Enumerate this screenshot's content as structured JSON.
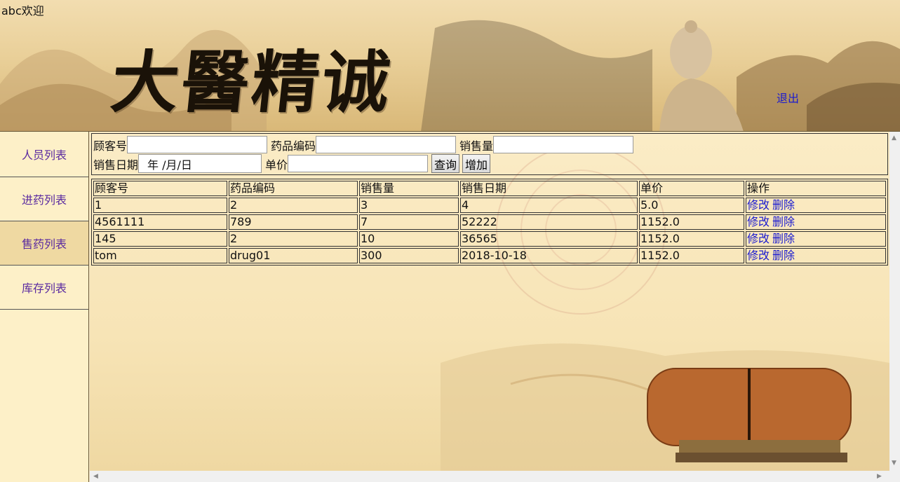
{
  "header": {
    "welcome": "abc欢迎",
    "logout": "退出"
  },
  "sidebar": {
    "items": [
      {
        "label": "人员列表",
        "active": false
      },
      {
        "label": "进药列表",
        "active": false
      },
      {
        "label": "售药列表",
        "active": true
      },
      {
        "label": "库存列表",
        "active": false
      }
    ]
  },
  "form": {
    "customer_label": "顾客号",
    "customer_value": "",
    "drug_code_label": "药品编码",
    "drug_code_value": "",
    "quantity_label": "销售量",
    "quantity_value": "",
    "date_label": "销售日期",
    "date_value": "年  /月/日",
    "price_label": "单价",
    "price_value": "",
    "query_button": "查询",
    "add_button": "增加"
  },
  "table": {
    "headers": [
      "顾客号",
      "药品编码",
      "销售量",
      "销售日期",
      "单价",
      "操作"
    ],
    "rows": [
      {
        "customer": "1",
        "drug_code": "2",
        "quantity": "3",
        "date": "4",
        "price": "5.0",
        "edit": "修改",
        "delete": "删除"
      },
      {
        "customer": "4561111",
        "drug_code": "789",
        "quantity": "7",
        "date": "52222",
        "price": "1152.0",
        "edit": "修改",
        "delete": "删除"
      },
      {
        "customer": "145",
        "drug_code": "2",
        "quantity": "10",
        "date": "36565",
        "price": "1152.0",
        "edit": "修改",
        "delete": "删除"
      },
      {
        "customer": "tom",
        "drug_code": "drug01",
        "quantity": "300",
        "date": "2018-10-18",
        "price": "1152.0",
        "edit": "修改",
        "delete": "删除"
      }
    ]
  },
  "colors": {
    "link": "#1a1ad0",
    "sidebar_text": "#5a2aa0",
    "sidebar_bg": "#fdf0c8",
    "sidebar_active_bg": "#efd9a2"
  }
}
